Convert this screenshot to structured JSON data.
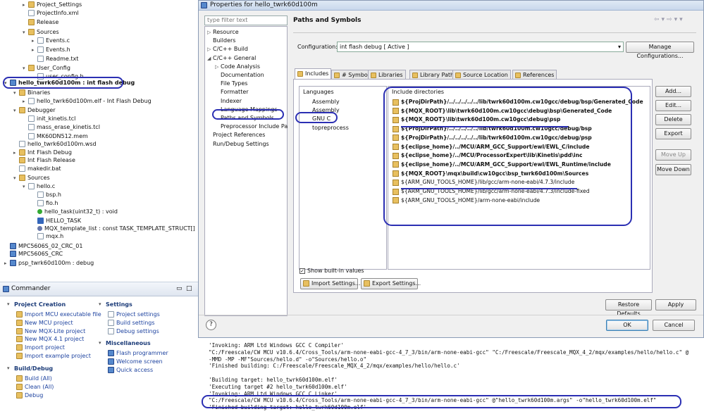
{
  "tree": {
    "rows": [
      {
        "label": "Project_Settings",
        "icon": "folder-icon",
        "indent": 2,
        "toggle": "▸"
      },
      {
        "label": "ProjectInfo.xml",
        "icon": "file-icon",
        "indent": 2,
        "toggle": ""
      },
      {
        "label": "Release",
        "icon": "folder-icon",
        "indent": 2,
        "toggle": ""
      },
      {
        "label": "Sources",
        "icon": "folder-icon",
        "indent": 2,
        "toggle": "▾"
      },
      {
        "label": "Events.c",
        "icon": "file-icon",
        "indent": 3,
        "toggle": "▸"
      },
      {
        "label": "Events.h",
        "icon": "file-icon",
        "indent": 3,
        "toggle": "▸"
      },
      {
        "label": "Readme.txt",
        "icon": "file-icon",
        "indent": 3,
        "toggle": ""
      },
      {
        "label": "User_Config",
        "icon": "folder-icon",
        "indent": 2,
        "toggle": "▾"
      },
      {
        "label": "user_config.h",
        "icon": "file-icon",
        "indent": 3,
        "toggle": ""
      },
      {
        "label": "hello_twrk60d100m  : int flash debug",
        "icon": "project-icon",
        "indent": 0,
        "toggle": "▾",
        "bold": true
      },
      {
        "label": "Binaries",
        "icon": "folder-icon",
        "indent": 1,
        "toggle": "▾"
      },
      {
        "label": "hello_twrk60d100m.elf - Int Flash Debug",
        "icon": "file-icon",
        "indent": 2,
        "toggle": "▸"
      },
      {
        "label": "Debugger",
        "icon": "folder-icon",
        "indent": 1,
        "toggle": "▾"
      },
      {
        "label": "init_kinetis.tcl",
        "icon": "file-icon",
        "indent": 2,
        "toggle": ""
      },
      {
        "label": "mass_erase_kinetis.tcl",
        "icon": "file-icon",
        "indent": 2,
        "toggle": ""
      },
      {
        "label": "MK60DN512.mem",
        "icon": "file-icon",
        "indent": 2,
        "toggle": ""
      },
      {
        "label": "hello_twrk60d100m.wsd",
        "icon": "file-icon",
        "indent": 1,
        "toggle": ""
      },
      {
        "label": "Int Flash Debug",
        "icon": "folder-icon",
        "indent": 1,
        "toggle": "▸"
      },
      {
        "label": "Int Flash Release",
        "icon": "folder-icon",
        "indent": 1,
        "toggle": ""
      },
      {
        "label": "makedir.bat",
        "icon": "file-icon",
        "indent": 1,
        "toggle": ""
      },
      {
        "label": "Sources",
        "icon": "folder-icon",
        "indent": 1,
        "toggle": "▾"
      },
      {
        "label": "hello.c",
        "icon": "file-icon",
        "indent": 2,
        "toggle": "▾"
      },
      {
        "label": "bsp.h",
        "icon": "file-icon",
        "indent": 3,
        "toggle": ""
      },
      {
        "label": "fio.h",
        "icon": "file-icon",
        "indent": 3,
        "toggle": ""
      },
      {
        "label": "hello_task(uint32_t) : void",
        "icon": "function-icon",
        "indent": 3,
        "toggle": ""
      },
      {
        "label": "HELLO_TASK",
        "icon": "hash-icon",
        "indent": 3,
        "toggle": ""
      },
      {
        "label": "MQX_template_list : const TASK_TEMPLATE_STRUCT[]",
        "icon": "variable-icon",
        "indent": 3,
        "toggle": ""
      },
      {
        "label": "mqx.h",
        "icon": "file-icon",
        "indent": 3,
        "toggle": ""
      },
      {
        "label": "MPC5606S_02_CRC_01",
        "icon": "project-icon",
        "indent": 0,
        "toggle": ""
      },
      {
        "label": "MPC5606S_CRC",
        "icon": "project-icon",
        "indent": 0,
        "toggle": ""
      },
      {
        "label": "psp_twrk60d100m  : debug",
        "icon": "project-icon",
        "indent": 0,
        "toggle": "▸"
      }
    ]
  },
  "commander": {
    "title": "Commander",
    "project_creation": {
      "title": "Project Creation",
      "items": [
        "Import MCU executable file",
        "New MCU project",
        "New MQX-Lite project",
        "New MQX 4.1 project",
        "Import project",
        "Import example project"
      ]
    },
    "settings": {
      "title": "Settings",
      "items": [
        "Project settings",
        "Build settings",
        "Debug settings"
      ]
    },
    "miscellaneous": {
      "title": "Miscellaneous",
      "items": [
        "Flash programmer",
        "Welcome screen",
        "Quick access"
      ]
    },
    "build_debug": {
      "title": "Build/Debug",
      "items": [
        "Build  (All)",
        "Clean  (All)",
        "Debug"
      ]
    }
  },
  "dialog": {
    "title": "Properties for hello_twrk60d100m",
    "filter_placeholder": "type filter text",
    "nav": [
      {
        "label": "Resource",
        "indent": 0,
        "toggle": "▷"
      },
      {
        "label": "Builders",
        "indent": 0,
        "toggle": ""
      },
      {
        "label": "C/C++ Build",
        "indent": 0,
        "toggle": "▷"
      },
      {
        "label": "C/C++ General",
        "indent": 0,
        "toggle": "◢"
      },
      {
        "label": "Code Analysis",
        "indent": 1,
        "toggle": "▷"
      },
      {
        "label": "Documentation",
        "indent": 1,
        "toggle": ""
      },
      {
        "label": "File Types",
        "indent": 1,
        "toggle": ""
      },
      {
        "label": "Formatter",
        "indent": 1,
        "toggle": ""
      },
      {
        "label": "Indexer",
        "indent": 1,
        "toggle": ""
      },
      {
        "label": "Language Mappings",
        "indent": 1,
        "toggle": ""
      },
      {
        "label": "Paths and Symbols",
        "indent": 1,
        "toggle": ""
      },
      {
        "label": "Preprocessor Include Pa",
        "indent": 1,
        "toggle": ""
      },
      {
        "label": "Project References",
        "indent": 0,
        "toggle": ""
      },
      {
        "label": "Run/Debug Settings",
        "indent": 0,
        "toggle": ""
      }
    ],
    "heading": "Paths and Symbols",
    "configuration_label": "Configuration:",
    "configuration_value": "int flash debug  [ Active ]",
    "manage_button": "Manage Configurations...",
    "tabs": [
      "Includes",
      "# Symbols",
      "Libraries",
      "Library Paths",
      "Source Location",
      "References"
    ],
    "languages_header": "Languages",
    "languages": [
      "Assembly",
      "Assembly",
      "GNU C",
      "topreprocess"
    ],
    "dirs_header": "Include directories",
    "include_dirs": [
      {
        "path": "${ProjDirPath}/../../../../../lib/twrk60d100m.cw10gcc/debug/bsp/Generated_Code",
        "bold": true
      },
      {
        "path": "${MQX_ROOT}\\lib\\twrk60d100m.cw10gcc\\debug\\bsp\\Generated_Code",
        "bold": true
      },
      {
        "path": "${MQX_ROOT}\\lib\\twrk60d100m.cw10gcc\\debug\\psp",
        "bold": true
      },
      {
        "path": "${ProjDirPath}/../../../../../lib/twrk60d100m.cw10gcc/debug/bsp",
        "bold": true
      },
      {
        "path": "${ProjDirPath}/../../../../../lib/twrk60d100m.cw10gcc/debug/psp",
        "bold": true
      },
      {
        "path": "${eclipse_home}/../MCU/ARM_GCC_Support/ewl/EWL_C/include",
        "bold": true
      },
      {
        "path": "${eclipse_home}/../MCU/ProcessorExpert\\lib\\Kinetis\\pdd\\inc",
        "bold": true
      },
      {
        "path": "${eclipse_home}/../MCU/ARM_GCC_Support/ewl/EWL_Runtime/include",
        "bold": true
      },
      {
        "path": "${MQX_ROOT}\\mqx\\build\\cw10gcc\\bsp_twrk60d100m\\Sources",
        "bold": true
      },
      {
        "path": "${ARM_GNU_TOOLS_HOME}/lib/gcc/arm-none-eabi/4.7.3/include",
        "bold": false
      },
      {
        "path": "${ARM_GNU_TOOLS_HOME}/lib/gcc/arm-none-eabi/4.7.3/include-fixed",
        "bold": false
      },
      {
        "path": "${ARM_GNU_TOOLS_HOME}/arm-none-eabi/include",
        "bold": false
      }
    ],
    "side_buttons": [
      {
        "label": "Add...",
        "enabled": true
      },
      {
        "label": "Edit...",
        "enabled": true
      },
      {
        "label": "Delete",
        "enabled": true
      },
      {
        "label": "Export",
        "enabled": true
      },
      {
        "label": "Move Up",
        "enabled": false
      },
      {
        "label": "Move Down",
        "enabled": true
      }
    ],
    "show_builtin_label": "Show built-in values",
    "show_builtin_checked": true,
    "import_settings": "Import Settings...",
    "export_settings": "Export Settings...",
    "restore_defaults": "Restore Defaults",
    "apply": "Apply",
    "ok": "OK",
    "cancel": "Cancel",
    "help_icon": "?"
  },
  "console": {
    "lines": [
      "'Invoking: ARM Ltd Windows GCC C Compiler'",
      "\"C:/Freescale/CW MCU v10.6.4/Cross_Tools/arm-none-eabi-gcc-4_7_3/bin/arm-none-eabi-gcc\" \"C:/Freescale/Freescale_MQX_4_2/mqx/examples/hello/hello.c\" @",
      "-MMD -MP -MF\"Sources/hello.d\" -o\"Sources/hello.o\"",
      "'Finished building: C:/Freescale/Freescale_MQX_4_2/mqx/examples/hello/hello.c'",
      "",
      "'Building target: hello_twrk60d100m.elf'",
      "'Executing target #2 hello_twrk60d100m.elf'",
      "'Invoking: ARM Ltd Windows GCC C Linker'",
      "\"C:/Freescale/CW MCU v10.6.4/Cross_Tools/arm-none-eabi-gcc-4_7_3/bin/arm-none-eabi-gcc\" @\"hello_twrk60d100m.args\" -o\"hello_twrk60d100m.elf\"",
      "'Finished building target: hello_twrk60d100m.elf'"
    ]
  },
  "colors": {
    "annotation": "#2b2fb3",
    "link": "#1f44a0",
    "section_title": "#1b3b78"
  }
}
